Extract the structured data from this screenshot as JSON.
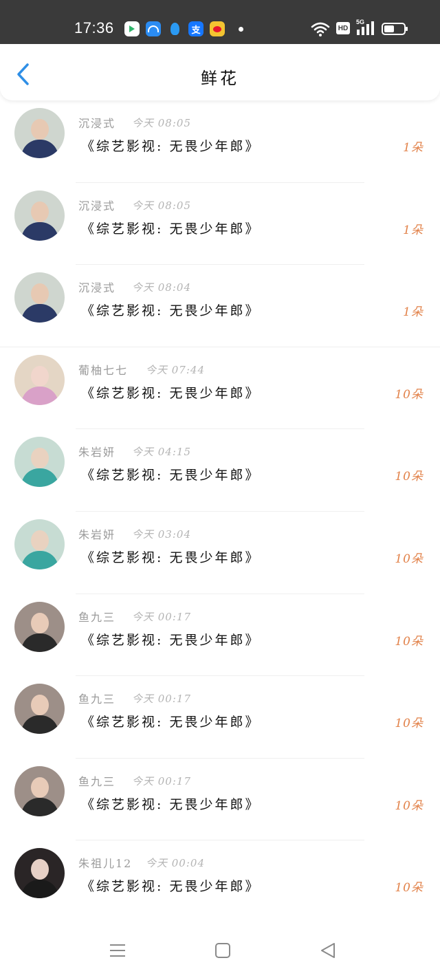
{
  "status_bar": {
    "time": "17:36",
    "apps": [
      "video-app-icon",
      "browser-app-icon",
      "qq-icon",
      "alipay-icon",
      "weibo-icon"
    ],
    "alipay_glyph": "支",
    "hd_label": "HD",
    "network_label": "5G",
    "battery_level": 0.5
  },
  "header": {
    "title": "鲜花",
    "accent_color": "#2f8fe6"
  },
  "list": {
    "items": [
      {
        "user": "沉浸式",
        "time": "今天 08:05",
        "title": "《综艺影视: 无畏少年郎》",
        "count": "1朵"
      },
      {
        "user": "沉浸式",
        "time": "今天 08:05",
        "title": "《综艺影视: 无畏少年郎》",
        "count": "1朵"
      },
      {
        "user": "沉浸式",
        "time": "今天 08:04",
        "title": "《综艺影视: 无畏少年郎》",
        "count": "1朵"
      },
      {
        "user": "葡柚七七",
        "time": "今天 07:44",
        "title": "《综艺影视: 无畏少年郎》",
        "count": "10朵"
      },
      {
        "user": "朱岩妍",
        "time": "今天 04:15",
        "title": "《综艺影视: 无畏少年郎》",
        "count": "10朵"
      },
      {
        "user": "朱岩妍",
        "time": "今天 03:04",
        "title": "《综艺影视: 无畏少年郎》",
        "count": "10朵"
      },
      {
        "user": "鱼九三",
        "time": "今天 00:17",
        "title": "《综艺影视: 无畏少年郎》",
        "count": "10朵"
      },
      {
        "user": "鱼九三",
        "time": "今天 00:17",
        "title": "《综艺影视: 无畏少年郎》",
        "count": "10朵"
      },
      {
        "user": "鱼九三",
        "time": "今天 00:17",
        "title": "《综艺影视: 无畏少年郎》",
        "count": "10朵"
      },
      {
        "user": "朱祖儿12",
        "time": "今天 00:04",
        "title": "《综艺影视: 无畏少年郎》",
        "count": "10朵"
      }
    ]
  },
  "colors": {
    "count": "#e2824a",
    "name": "#9a9a9a",
    "timestamp": "#b4b4b4"
  },
  "nav_bar": {
    "icons": [
      "menu-icon",
      "home-square-icon",
      "back-triangle-icon"
    ]
  }
}
